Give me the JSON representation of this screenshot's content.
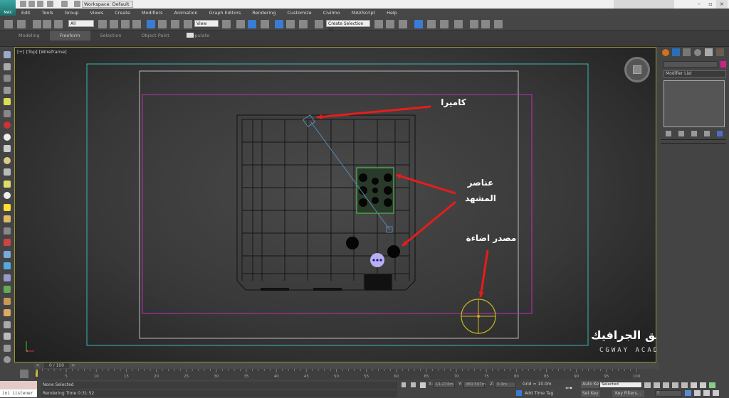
{
  "app": {
    "logo": "MAX",
    "workspace": "Workspace: Default"
  },
  "menu": [
    "Edit",
    "Tools",
    "Group",
    "Views",
    "Create",
    "Modifiers",
    "Animation",
    "Graph Editors",
    "Rendering",
    "Customize",
    "Civilmo",
    "MAXScript",
    "Help"
  ],
  "toolbar": {
    "selection_filter": "All",
    "ref_coord": "View",
    "named_selection": "Create Selection Se"
  },
  "ribbon_tabs": [
    {
      "label": "Modeling",
      "active": false
    },
    {
      "label": "Freeform",
      "active": true
    },
    {
      "label": "Selection",
      "active": false
    },
    {
      "label": "Object Paint",
      "active": false
    },
    {
      "label": "Populate",
      "active": false
    }
  ],
  "viewport": {
    "label": "[+] [Top] [Wireframe]"
  },
  "annotations": {
    "camera": "كاميرا",
    "scene_elements_1": "عناصر",
    "scene_elements_2": "المشهد",
    "light_source": "مصدر اضاءة",
    "arrow_color": "#e81c1c"
  },
  "command_panel": {
    "modifier_list": "Modifier List",
    "object_color": "#d0208a"
  },
  "timeline": {
    "frame_display": "0 / 100",
    "current": 0,
    "end": 100,
    "ticks": [
      5,
      10,
      15,
      20,
      25,
      30,
      35,
      40,
      45,
      50,
      55,
      60,
      65,
      70,
      75,
      80,
      85,
      90,
      95,
      100
    ]
  },
  "status": {
    "listener": "ini Listener",
    "selection": "None Selected",
    "rendering_time": "Rendering Time  0:31:52",
    "x_label": "X:",
    "x": "11.274m",
    "y_label": "Y:",
    "y": "380.507m",
    "z_label": "Z:",
    "z": "0.0m",
    "grid": "Grid = 10.0m",
    "add_time_tag": "Add Time Tag",
    "auto_key": "Auto Key",
    "key_mode": "Selected",
    "set_key": "Set Key",
    "key_filters": "Key Filters...",
    "frame": "0"
  },
  "watermark": {
    "arabic": "طريق الجرافيك",
    "english": "CGWAY ACADEMY"
  }
}
